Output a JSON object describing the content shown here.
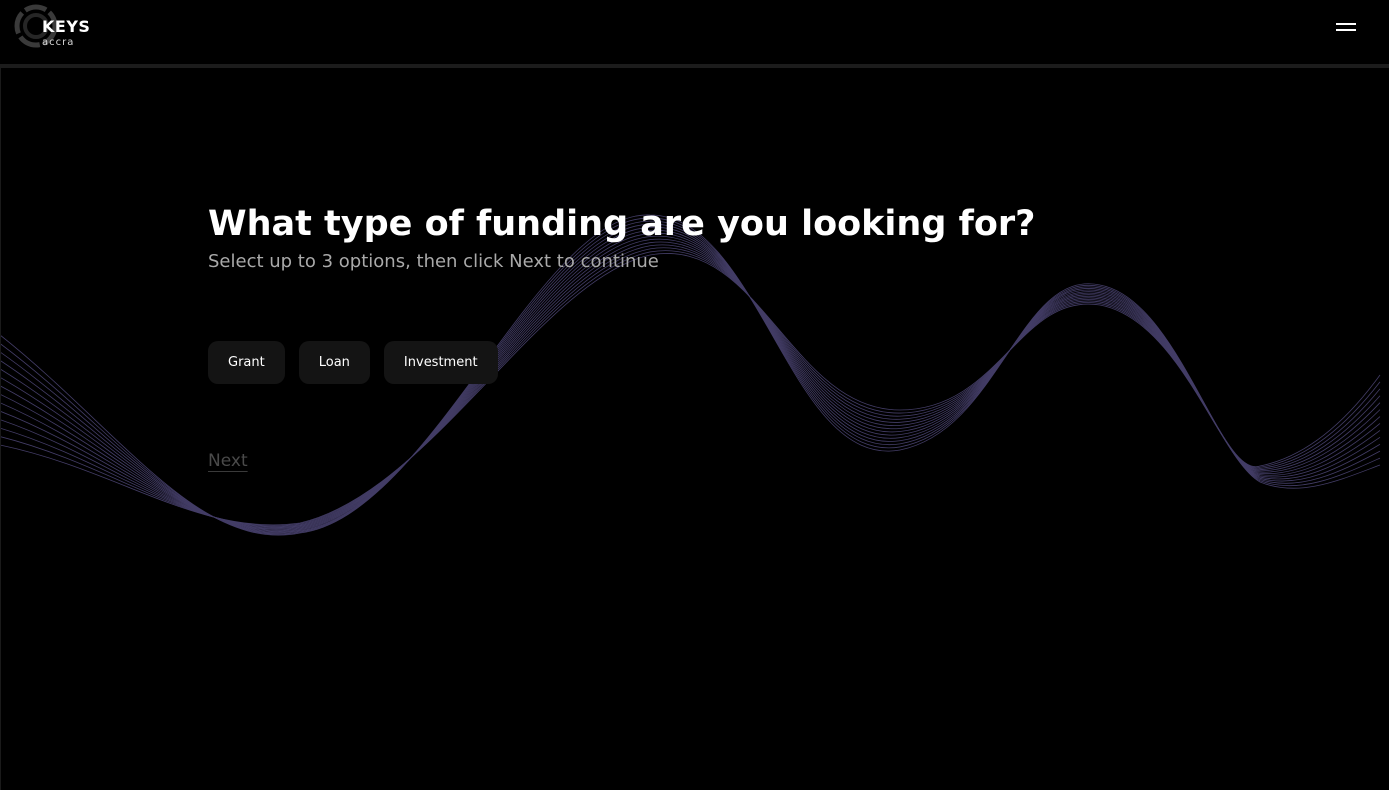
{
  "header": {
    "logo_word": "KEYS",
    "logo_sub": "accra",
    "menu_icon": "hamburger-menu-icon"
  },
  "question": {
    "title": "What type of funding are you looking for?",
    "subtitle": "Select up to 3 options, then click Next to continue",
    "options": [
      {
        "label": "Grant"
      },
      {
        "label": "Loan"
      },
      {
        "label": "Investment"
      }
    ],
    "next_label": "Next"
  },
  "colors": {
    "background": "#000000",
    "wave": "#4b4472",
    "option_bg": "#141414",
    "title": "#ffffff",
    "subtitle": "#a9a9a9",
    "next_disabled": "#4a4a4a"
  }
}
